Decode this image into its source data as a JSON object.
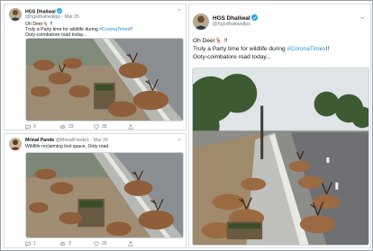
{
  "tweets": [
    {
      "name": "HGS Dhaliwal",
      "handle": "@hgsdhaliwalips",
      "date": "Mar 26",
      "lines": [
        "Oh Deer🦌 !!",
        "Truly a Party time for wildlife during",
        "Ooty-coimbatore road today..."
      ],
      "hashtag": "#CoronaTimes",
      "after_hashtag": "!!",
      "stats": {
        "replies": "9",
        "retweets": "23",
        "likes": "35"
      }
    },
    {
      "name": "Mrinal Pande",
      "handle": "@MrinalPande1",
      "date": "Mar 26",
      "lines": [
        "Wildlife reclaiming lost space, Ooty road"
      ],
      "stats": {
        "replies": "1",
        "retweets": "3",
        "likes": "26"
      }
    },
    {
      "name": "HGS Dhaliwal",
      "handle": "@hgsdhaliwalips",
      "lines": [
        "Oh Deer🦌 !!",
        "Truly a Party time for wildlife during",
        "Ooty-coimbatore road today..."
      ],
      "hashtag": "#CoronaTimes",
      "after_hashtag": "!!"
    }
  ],
  "icons": [
    "verified-badge-icon",
    "chevron-down-icon",
    "reply-icon",
    "retweet-icon",
    "like-icon",
    "share-icon"
  ],
  "colors": {
    "accent": "#1da1f2",
    "hashtag": "#1b8ee0",
    "muted": "#66757f"
  }
}
